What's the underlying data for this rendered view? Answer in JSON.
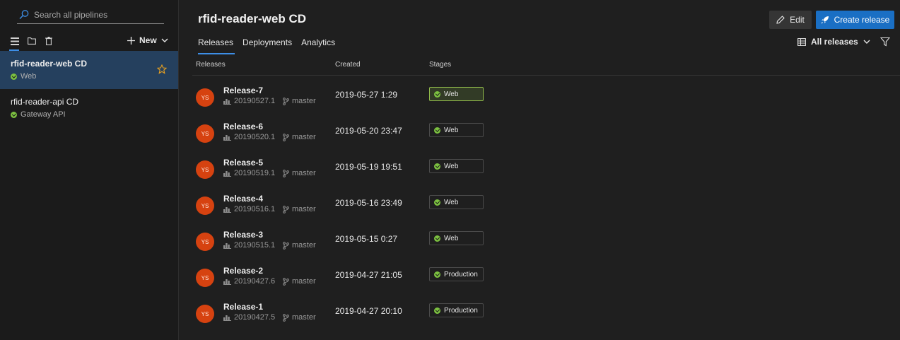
{
  "sidebar": {
    "search_placeholder": "Search all pipelines",
    "new_label": "New",
    "items": [
      {
        "name": "rfid-reader-web CD",
        "stage": "Web",
        "selected": true,
        "status": "succeeded"
      },
      {
        "name": "rfid-reader-api CD",
        "stage": "Gateway API",
        "selected": false,
        "status": "succeeded"
      }
    ]
  },
  "header": {
    "title": "rfid-reader-web CD",
    "edit_label": "Edit",
    "create_label": "Create release",
    "all_releases_label": "All releases"
  },
  "tabs": [
    "Releases",
    "Deployments",
    "Analytics"
  ],
  "columns": {
    "releases": "Releases",
    "created": "Created",
    "stages": "Stages"
  },
  "releases": [
    {
      "name": "Release-7",
      "avatar": "YS",
      "build": "20190527.1",
      "branch": "master",
      "created": "2019-05-27 1:29",
      "stage": "Web",
      "highlight": true
    },
    {
      "name": "Release-6",
      "avatar": "YS",
      "build": "20190520.1",
      "branch": "master",
      "created": "2019-05-20 23:47",
      "stage": "Web"
    },
    {
      "name": "Release-5",
      "avatar": "YS",
      "build": "20190519.1",
      "branch": "master",
      "created": "2019-05-19 19:51",
      "stage": "Web"
    },
    {
      "name": "Release-4",
      "avatar": "YS",
      "build": "20190516.1",
      "branch": "master",
      "created": "2019-05-16 23:49",
      "stage": "Web"
    },
    {
      "name": "Release-3",
      "avatar": "YS",
      "build": "20190515.1",
      "branch": "master",
      "created": "2019-05-15 0:27",
      "stage": "Web"
    },
    {
      "name": "Release-2",
      "avatar": "YS",
      "build": "20190427.6",
      "branch": "master",
      "created": "2019-04-27 21:05",
      "stage": "Production"
    },
    {
      "name": "Release-1",
      "avatar": "YS",
      "build": "20190427.5",
      "branch": "master",
      "created": "2019-04-27 20:10",
      "stage": "Production"
    }
  ],
  "colors": {
    "accent": "#3d8ee6",
    "primary_button": "#1a6fc4",
    "success": "#7cc140",
    "avatar": "#d64210",
    "selected_row": "#25405e"
  }
}
